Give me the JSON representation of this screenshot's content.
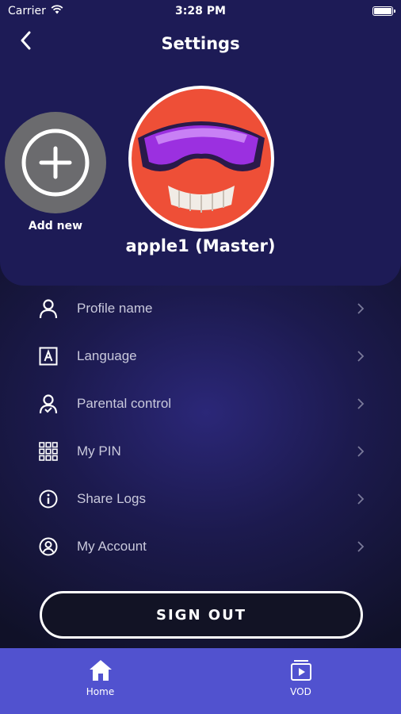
{
  "status_bar": {
    "carrier": "Carrier",
    "time": "3:28 PM",
    "battery_level": 1.0
  },
  "header": {
    "title": "Settings"
  },
  "profiles": {
    "add_new_label": "Add new",
    "current_profile": "apple1 (Master)"
  },
  "menu": {
    "items": [
      {
        "label": "Profile name",
        "icon": "user-icon"
      },
      {
        "label": "Language",
        "icon": "language-icon"
      },
      {
        "label": "Parental control",
        "icon": "parental-control-icon"
      },
      {
        "label": "My PIN",
        "icon": "keypad-icon"
      },
      {
        "label": "Share Logs",
        "icon": "info-icon"
      },
      {
        "label": "My Account",
        "icon": "account-circle-icon"
      }
    ]
  },
  "sign_out_label": "SIGN OUT",
  "tab_bar": {
    "tabs": [
      {
        "label": "Home",
        "icon": "home-icon"
      },
      {
        "label": "VOD",
        "icon": "vod-icon"
      }
    ]
  },
  "colors": {
    "header_bg": "#1d1b56",
    "tab_bar_bg": "#5152cf",
    "avatar_bg": "#ee4f37",
    "goggles": "#9b30e0",
    "add_new_bg": "#6b6b6e"
  }
}
